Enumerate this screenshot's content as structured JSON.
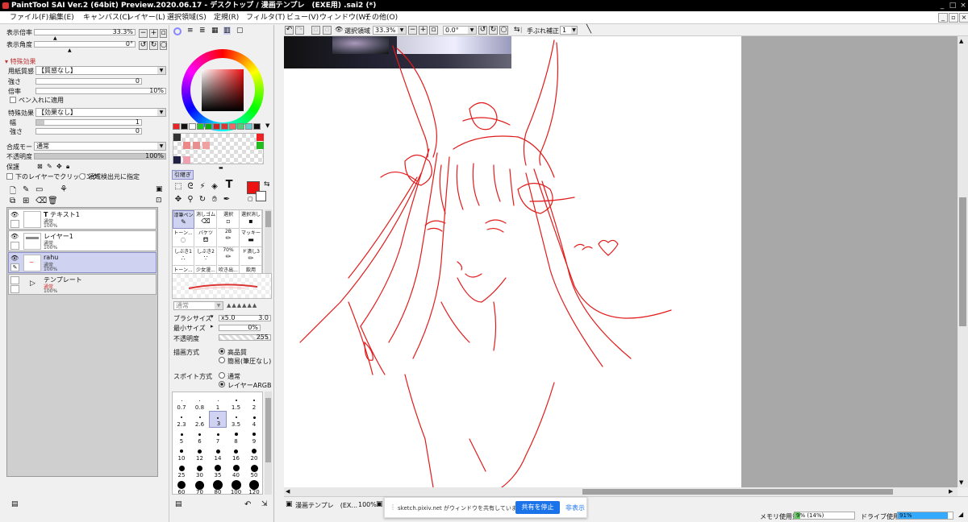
{
  "window": {
    "title": "PaintTool SAI Ver.2 (64bit) Preview.2020.06.17 - デスクトップ / 漫画テンプレ　(EXE用) .sai2 (*)"
  },
  "menu": {
    "items": [
      "ファイル(F)",
      "編集(E)",
      "キャンバス(C)",
      "レイヤー(L)",
      "選択領域(S)",
      "定規(R)",
      "フィルタ(T)",
      "ビュー(V)",
      "ウィンドウ(W)",
      "その他(O)"
    ]
  },
  "nav": {
    "zoom_label": "表示倍率",
    "zoom_value": "33.3%",
    "angle_label": "表示角度",
    "angle_value": "0°"
  },
  "effects": {
    "header": "特殊効果",
    "paper_label": "用紙質感",
    "paper_value": "【質感なし】",
    "strength_label": "強さ",
    "strength_value": "0",
    "scale_label": "倍率",
    "scale_value": "10%",
    "apply_pen_label": "ペン入れに適用",
    "effect_label": "特殊効果",
    "effect_value": "【効果なし】",
    "width_label": "幅",
    "width_value": "1",
    "strength2_label": "強さ",
    "strength2_value": "0"
  },
  "layer_props": {
    "blend_label": "合成モード",
    "blend_value": "通常",
    "opacity_label": "不透明度",
    "opacity_value": "100%",
    "opacity_percent": 100,
    "protect_label": "保護",
    "clip_label": "下のレイヤーでクリッピング",
    "source_label": "領域検出元に指定"
  },
  "layers": [
    {
      "name": "テキスト1",
      "mode": "通常",
      "opacity": "100%",
      "selected": false,
      "kind": "text"
    },
    {
      "name": "レイヤー1",
      "mode": "通常",
      "opacity": "100%",
      "selected": false,
      "kind": "raster"
    },
    {
      "name": "rahu",
      "mode": "通常",
      "opacity": "100%",
      "selected": true,
      "kind": "raster"
    },
    {
      "name": "テンプレート",
      "mode": "通常",
      "opacity": "100%",
      "selected": false,
      "kind": "folder"
    }
  ],
  "color": {
    "primary": "#ee1111",
    "swatches": [
      "#ee2222",
      "#111111",
      "#ffffff",
      "#22cc22",
      "#11aa11",
      "#cc2222",
      "#dd3333",
      "#ee6666",
      "#55cc77",
      "#66cccc",
      "#111111"
    ],
    "pick_label": "引継ぎ"
  },
  "brushes": {
    "row1": [
      "漆筆ペン",
      "消しゴム",
      "選択",
      "選択消し"
    ],
    "row2": [
      "トーン...",
      "バケツ",
      "2B",
      "マッキー"
    ],
    "row3": [
      "しぶき1",
      "しぶき2",
      "70%",
      "ド潰し3"
    ],
    "row4": [
      "トーン...",
      "少女漫...",
      "吹き出...",
      "飲用"
    ],
    "mode_value": "通常"
  },
  "brush_settings": {
    "size_label": "ブラシサイズ",
    "size_mult": "x5.0",
    "size_value": "3.0",
    "min_label": "最小サイズ",
    "min_value": "0%",
    "opacity_label": "不透明度",
    "opacity_value": "255",
    "draw_label": "描画方式",
    "draw_hq": "高品質",
    "draw_simple": "簡易(筆圧なし)",
    "spoit_label": "スポイト方式",
    "spoit_normal": "通常",
    "spoit_argb": "レイヤーARGB"
  },
  "sizes": [
    "0.7",
    "0.8",
    "1",
    "1.5",
    "2",
    "2.3",
    "2.6",
    "3",
    "3.5",
    "4",
    "5",
    "6",
    "7",
    "8",
    "9",
    "10",
    "12",
    "14",
    "16",
    "20",
    "25",
    "30",
    "35",
    "40",
    "50",
    "60",
    "70",
    "80",
    "100",
    "120"
  ],
  "canvas_toolbar": {
    "select_label": "選択領域",
    "zoom_value": "33.3%",
    "angle_value": "0.0°",
    "stab_label": "手ぶれ補正",
    "stab_value": "1"
  },
  "taskbar": {
    "doc1": "漫画テンプレ　(EX...",
    "doc1_zoom": "100%",
    "share_text": "sketch.pixiv.net がウィンドウを共有しています。",
    "stop_button": "共有を停止",
    "hide_button": "非表示",
    "memory_label": "メモリ使用量",
    "memory_value": "9% (14%)",
    "memory_percent": 9,
    "drive_label": "ドライブ使用量",
    "drive_value": "91%",
    "drive_percent": 91
  }
}
